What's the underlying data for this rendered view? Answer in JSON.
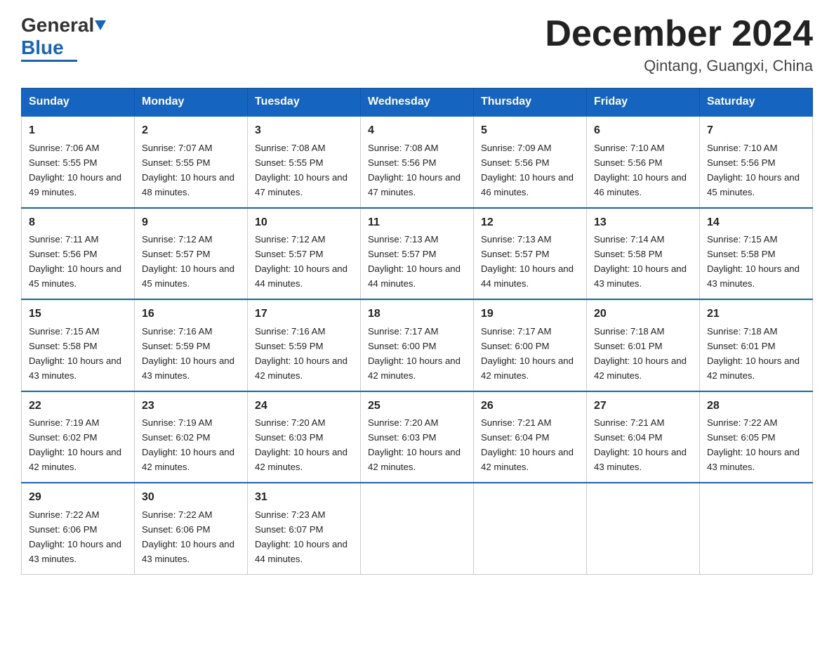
{
  "header": {
    "logo_general": "General",
    "logo_blue": "Blue",
    "title": "December 2024",
    "subtitle": "Qintang, Guangxi, China"
  },
  "days_of_week": [
    "Sunday",
    "Monday",
    "Tuesday",
    "Wednesday",
    "Thursday",
    "Friday",
    "Saturday"
  ],
  "weeks": [
    [
      {
        "day": 1,
        "sunrise": "7:06 AM",
        "sunset": "5:55 PM",
        "daylight": "10 hours and 49 minutes."
      },
      {
        "day": 2,
        "sunrise": "7:07 AM",
        "sunset": "5:55 PM",
        "daylight": "10 hours and 48 minutes."
      },
      {
        "day": 3,
        "sunrise": "7:08 AM",
        "sunset": "5:55 PM",
        "daylight": "10 hours and 47 minutes."
      },
      {
        "day": 4,
        "sunrise": "7:08 AM",
        "sunset": "5:56 PM",
        "daylight": "10 hours and 47 minutes."
      },
      {
        "day": 5,
        "sunrise": "7:09 AM",
        "sunset": "5:56 PM",
        "daylight": "10 hours and 46 minutes."
      },
      {
        "day": 6,
        "sunrise": "7:10 AM",
        "sunset": "5:56 PM",
        "daylight": "10 hours and 46 minutes."
      },
      {
        "day": 7,
        "sunrise": "7:10 AM",
        "sunset": "5:56 PM",
        "daylight": "10 hours and 45 minutes."
      }
    ],
    [
      {
        "day": 8,
        "sunrise": "7:11 AM",
        "sunset": "5:56 PM",
        "daylight": "10 hours and 45 minutes."
      },
      {
        "day": 9,
        "sunrise": "7:12 AM",
        "sunset": "5:57 PM",
        "daylight": "10 hours and 45 minutes."
      },
      {
        "day": 10,
        "sunrise": "7:12 AM",
        "sunset": "5:57 PM",
        "daylight": "10 hours and 44 minutes."
      },
      {
        "day": 11,
        "sunrise": "7:13 AM",
        "sunset": "5:57 PM",
        "daylight": "10 hours and 44 minutes."
      },
      {
        "day": 12,
        "sunrise": "7:13 AM",
        "sunset": "5:57 PM",
        "daylight": "10 hours and 44 minutes."
      },
      {
        "day": 13,
        "sunrise": "7:14 AM",
        "sunset": "5:58 PM",
        "daylight": "10 hours and 43 minutes."
      },
      {
        "day": 14,
        "sunrise": "7:15 AM",
        "sunset": "5:58 PM",
        "daylight": "10 hours and 43 minutes."
      }
    ],
    [
      {
        "day": 15,
        "sunrise": "7:15 AM",
        "sunset": "5:58 PM",
        "daylight": "10 hours and 43 minutes."
      },
      {
        "day": 16,
        "sunrise": "7:16 AM",
        "sunset": "5:59 PM",
        "daylight": "10 hours and 43 minutes."
      },
      {
        "day": 17,
        "sunrise": "7:16 AM",
        "sunset": "5:59 PM",
        "daylight": "10 hours and 42 minutes."
      },
      {
        "day": 18,
        "sunrise": "7:17 AM",
        "sunset": "6:00 PM",
        "daylight": "10 hours and 42 minutes."
      },
      {
        "day": 19,
        "sunrise": "7:17 AM",
        "sunset": "6:00 PM",
        "daylight": "10 hours and 42 minutes."
      },
      {
        "day": 20,
        "sunrise": "7:18 AM",
        "sunset": "6:01 PM",
        "daylight": "10 hours and 42 minutes."
      },
      {
        "day": 21,
        "sunrise": "7:18 AM",
        "sunset": "6:01 PM",
        "daylight": "10 hours and 42 minutes."
      }
    ],
    [
      {
        "day": 22,
        "sunrise": "7:19 AM",
        "sunset": "6:02 PM",
        "daylight": "10 hours and 42 minutes."
      },
      {
        "day": 23,
        "sunrise": "7:19 AM",
        "sunset": "6:02 PM",
        "daylight": "10 hours and 42 minutes."
      },
      {
        "day": 24,
        "sunrise": "7:20 AM",
        "sunset": "6:03 PM",
        "daylight": "10 hours and 42 minutes."
      },
      {
        "day": 25,
        "sunrise": "7:20 AM",
        "sunset": "6:03 PM",
        "daylight": "10 hours and 42 minutes."
      },
      {
        "day": 26,
        "sunrise": "7:21 AM",
        "sunset": "6:04 PM",
        "daylight": "10 hours and 42 minutes."
      },
      {
        "day": 27,
        "sunrise": "7:21 AM",
        "sunset": "6:04 PM",
        "daylight": "10 hours and 43 minutes."
      },
      {
        "day": 28,
        "sunrise": "7:22 AM",
        "sunset": "6:05 PM",
        "daylight": "10 hours and 43 minutes."
      }
    ],
    [
      {
        "day": 29,
        "sunrise": "7:22 AM",
        "sunset": "6:06 PM",
        "daylight": "10 hours and 43 minutes."
      },
      {
        "day": 30,
        "sunrise": "7:22 AM",
        "sunset": "6:06 PM",
        "daylight": "10 hours and 43 minutes."
      },
      {
        "day": 31,
        "sunrise": "7:23 AM",
        "sunset": "6:07 PM",
        "daylight": "10 hours and 44 minutes."
      },
      null,
      null,
      null,
      null
    ]
  ],
  "colors": {
    "header_bg": "#1565c0",
    "header_border": "#1255a0",
    "row_top_border": "#1565c0"
  }
}
